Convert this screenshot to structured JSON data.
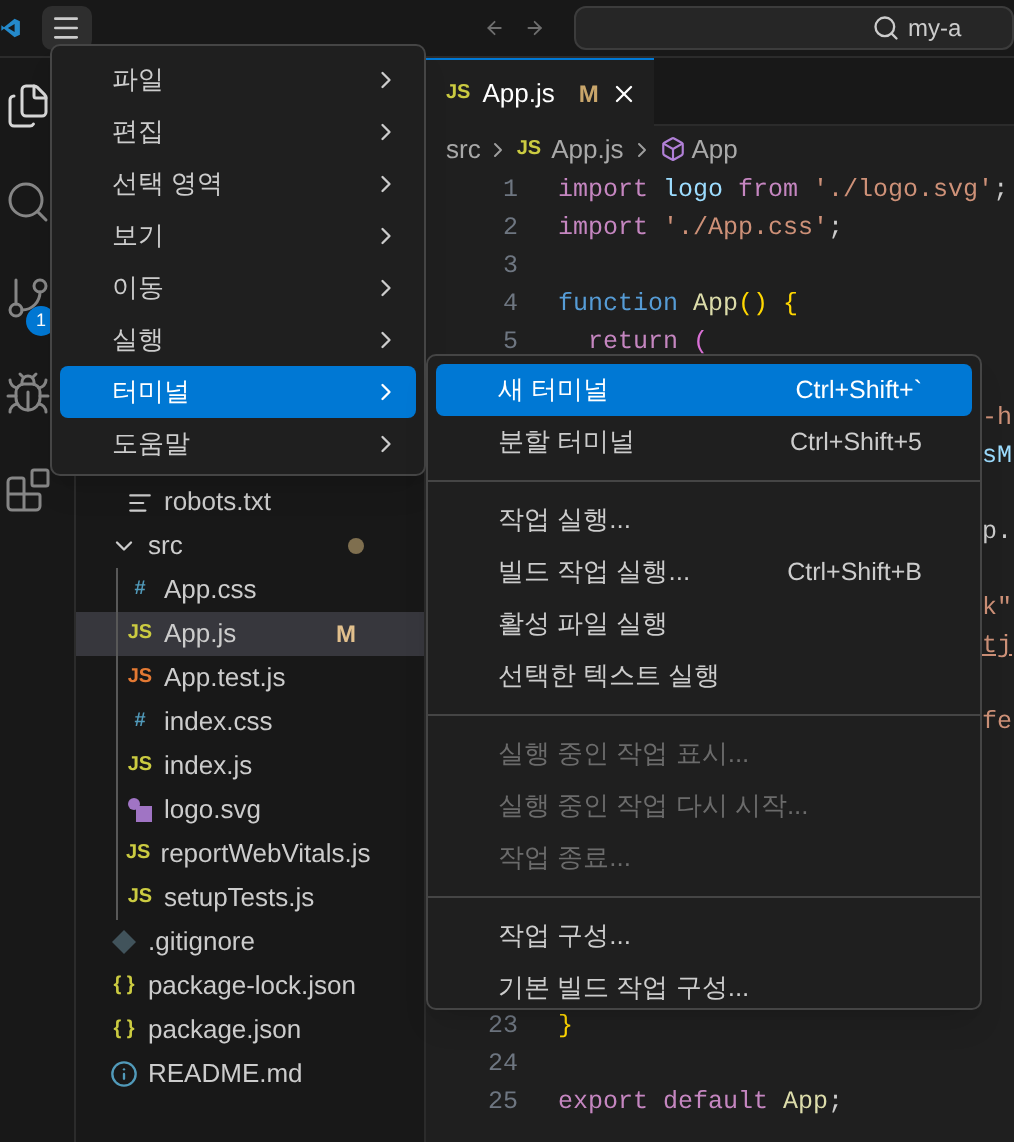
{
  "title_bar": {
    "search_text": "my-a"
  },
  "activity_bar": {
    "items": [
      {
        "kind": "files",
        "selected": true
      },
      {
        "kind": "search",
        "selected": false
      },
      {
        "kind": "source-control",
        "selected": false,
        "badge": "1"
      },
      {
        "kind": "run",
        "selected": false
      },
      {
        "kind": "extensions",
        "selected": false
      }
    ]
  },
  "explorer": {
    "tree": [
      {
        "children": [
          {
            "name": "robots.txt",
            "icon": {
              "kind": "lines"
            },
            "selected": false
          }
        ]
      },
      {
        "name": "src",
        "folder": true,
        "expanded": true,
        "modified_dot": true,
        "selected": false,
        "children": [
          {
            "name": "App.css",
            "icon": {
              "kind": "text",
              "text": "#",
              "color": "#519aba"
            },
            "selected": false
          },
          {
            "name": "App.js",
            "icon": {
              "kind": "text",
              "text": "JS",
              "color": "#cbcb41"
            },
            "selected": true,
            "status": "M"
          },
          {
            "name": "App.test.js",
            "icon": {
              "kind": "text",
              "text": "JS",
              "color": "#e37933"
            },
            "selected": false
          },
          {
            "name": "index.css",
            "icon": {
              "kind": "text",
              "text": "#",
              "color": "#519aba"
            },
            "selected": false
          },
          {
            "name": "index.js",
            "icon": {
              "kind": "text",
              "text": "JS",
              "color": "#cbcb41"
            },
            "selected": false
          },
          {
            "name": "logo.svg",
            "icon": {
              "kind": "image"
            },
            "selected": false
          },
          {
            "name": "reportWebVitals.js",
            "icon": {
              "kind": "text",
              "text": "JS",
              "color": "#cbcb41"
            },
            "selected": false
          },
          {
            "name": "setupTests.js",
            "icon": {
              "kind": "text",
              "text": "JS",
              "color": "#cbcb41"
            },
            "selected": false
          }
        ]
      },
      {
        "name": ".gitignore",
        "icon": {
          "kind": "git"
        },
        "selected": false
      },
      {
        "name": "package-lock.json",
        "icon": {
          "kind": "text",
          "text": "{ }",
          "color": "#cbcb41"
        },
        "selected": false
      },
      {
        "name": "package.json",
        "icon": {
          "kind": "text",
          "text": "{ }",
          "color": "#cbcb41"
        },
        "selected": false
      },
      {
        "name": "README.md",
        "icon": {
          "kind": "info"
        },
        "selected": false
      }
    ]
  },
  "editor": {
    "tabs": [
      {
        "icon_text": "JS",
        "label": "App.js",
        "status": "M",
        "selected": true
      }
    ],
    "breadcrumbs": [
      {
        "kind": "folder",
        "label": "src"
      },
      {
        "kind": "file",
        "icon_text": "JS",
        "label": "App.js"
      },
      {
        "kind": "symbol",
        "label": "App"
      }
    ],
    "lines": [
      {
        "number": "1",
        "tokens": [
          {
            "kind": "keyword",
            "text": "import "
          },
          {
            "kind": "variable",
            "text": "logo "
          },
          {
            "kind": "keyword",
            "text": "from "
          },
          {
            "kind": "string",
            "text": "'./logo.svg'"
          },
          {
            "kind": "plain",
            "text": ";"
          }
        ]
      },
      {
        "number": "2",
        "tokens": [
          {
            "kind": "keyword",
            "text": "import "
          },
          {
            "kind": "string",
            "text": "'./App.css'"
          },
          {
            "kind": "plain",
            "text": ";"
          }
        ]
      },
      {
        "number": "3"
      },
      {
        "number": "4",
        "tokens": [
          {
            "kind": "storage",
            "text": "function "
          },
          {
            "kind": "function",
            "text": "App"
          },
          {
            "kind": "bracket",
            "text": "() {"
          }
        ]
      },
      {
        "number": "5",
        "tokens": [
          {
            "kind": "keyword",
            "text": "  return "
          },
          {
            "kind": "bracket2",
            "text": "("
          }
        ]
      },
      {
        "kind": "covered"
      },
      {
        "kind": "fragment",
        "tokens": [
          {
            "kind": "string",
            "text": "-h"
          }
        ]
      },
      {
        "kind": "fragment",
        "tokens": [
          {
            "kind": "variable",
            "text": "sM"
          }
        ]
      },
      {
        "kind": "covered"
      },
      {
        "kind": "fragment",
        "tokens": [
          {
            "kind": "plain",
            "text": "p."
          }
        ]
      },
      {
        "kind": "covered"
      },
      {
        "kind": "fragment",
        "tokens": [
          {
            "kind": "string",
            "text": "k\""
          }
        ]
      },
      {
        "kind": "fragment",
        "tokens": [
          {
            "kind": "link",
            "text": "tj"
          }
        ]
      },
      {
        "kind": "covered"
      },
      {
        "kind": "fragment",
        "tokens": [
          {
            "kind": "string",
            "text": "fe"
          }
        ]
      },
      {
        "kind": "covered"
      },
      {
        "kind": "covered"
      },
      {
        "kind": "covered"
      },
      {
        "kind": "covered"
      },
      {
        "kind": "covered"
      },
      {
        "kind": "covered"
      },
      {
        "kind": "covered"
      },
      {
        "number": "23",
        "tokens": [
          {
            "kind": "bracket",
            "text": "}"
          }
        ]
      },
      {
        "number": "24"
      },
      {
        "number": "25",
        "tokens": [
          {
            "kind": "keyword",
            "text": "export default "
          },
          {
            "kind": "function",
            "text": "App"
          },
          {
            "kind": "plain",
            "text": ";"
          }
        ]
      }
    ]
  },
  "menu": [
    {
      "label": "파일",
      "selected": false
    },
    {
      "label": "편집",
      "selected": false
    },
    {
      "label": "선택 영역",
      "selected": false
    },
    {
      "label": "보기",
      "selected": false
    },
    {
      "label": "이동",
      "selected": false
    },
    {
      "label": "실행",
      "selected": false
    },
    {
      "label": "터미널",
      "selected": true
    },
    {
      "label": "도움말",
      "selected": false
    }
  ],
  "submenu": [
    {
      "kind": "item",
      "label": "새 터미널",
      "shortcut": "Ctrl+Shift+`",
      "selected": true,
      "disabled": false
    },
    {
      "kind": "item",
      "label": "분할 터미널",
      "shortcut": "Ctrl+Shift+5",
      "selected": false,
      "disabled": false
    },
    {
      "kind": "separator"
    },
    {
      "kind": "item",
      "label": "작업 실행...",
      "selected": false,
      "disabled": false
    },
    {
      "kind": "item",
      "label": "빌드 작업 실행...",
      "shortcut": "Ctrl+Shift+B",
      "selected": false,
      "disabled": false
    },
    {
      "kind": "item",
      "label": "활성 파일 실행",
      "selected": false,
      "disabled": false
    },
    {
      "kind": "item",
      "label": "선택한 텍스트 실행",
      "selected": false,
      "disabled": false
    },
    {
      "kind": "separator"
    },
    {
      "kind": "item",
      "label": "실행 중인 작업 표시...",
      "selected": false,
      "disabled": true
    },
    {
      "kind": "item",
      "label": "실행 중인 작업 다시 시작...",
      "selected": false,
      "disabled": true
    },
    {
      "kind": "item",
      "label": "작업 종료...",
      "selected": false,
      "disabled": true
    },
    {
      "kind": "separator"
    },
    {
      "kind": "item",
      "label": "작업 구성...",
      "selected": false,
      "disabled": false
    },
    {
      "kind": "item",
      "label": "기본 빌드 작업 구성...",
      "selected": false,
      "disabled": false
    }
  ]
}
